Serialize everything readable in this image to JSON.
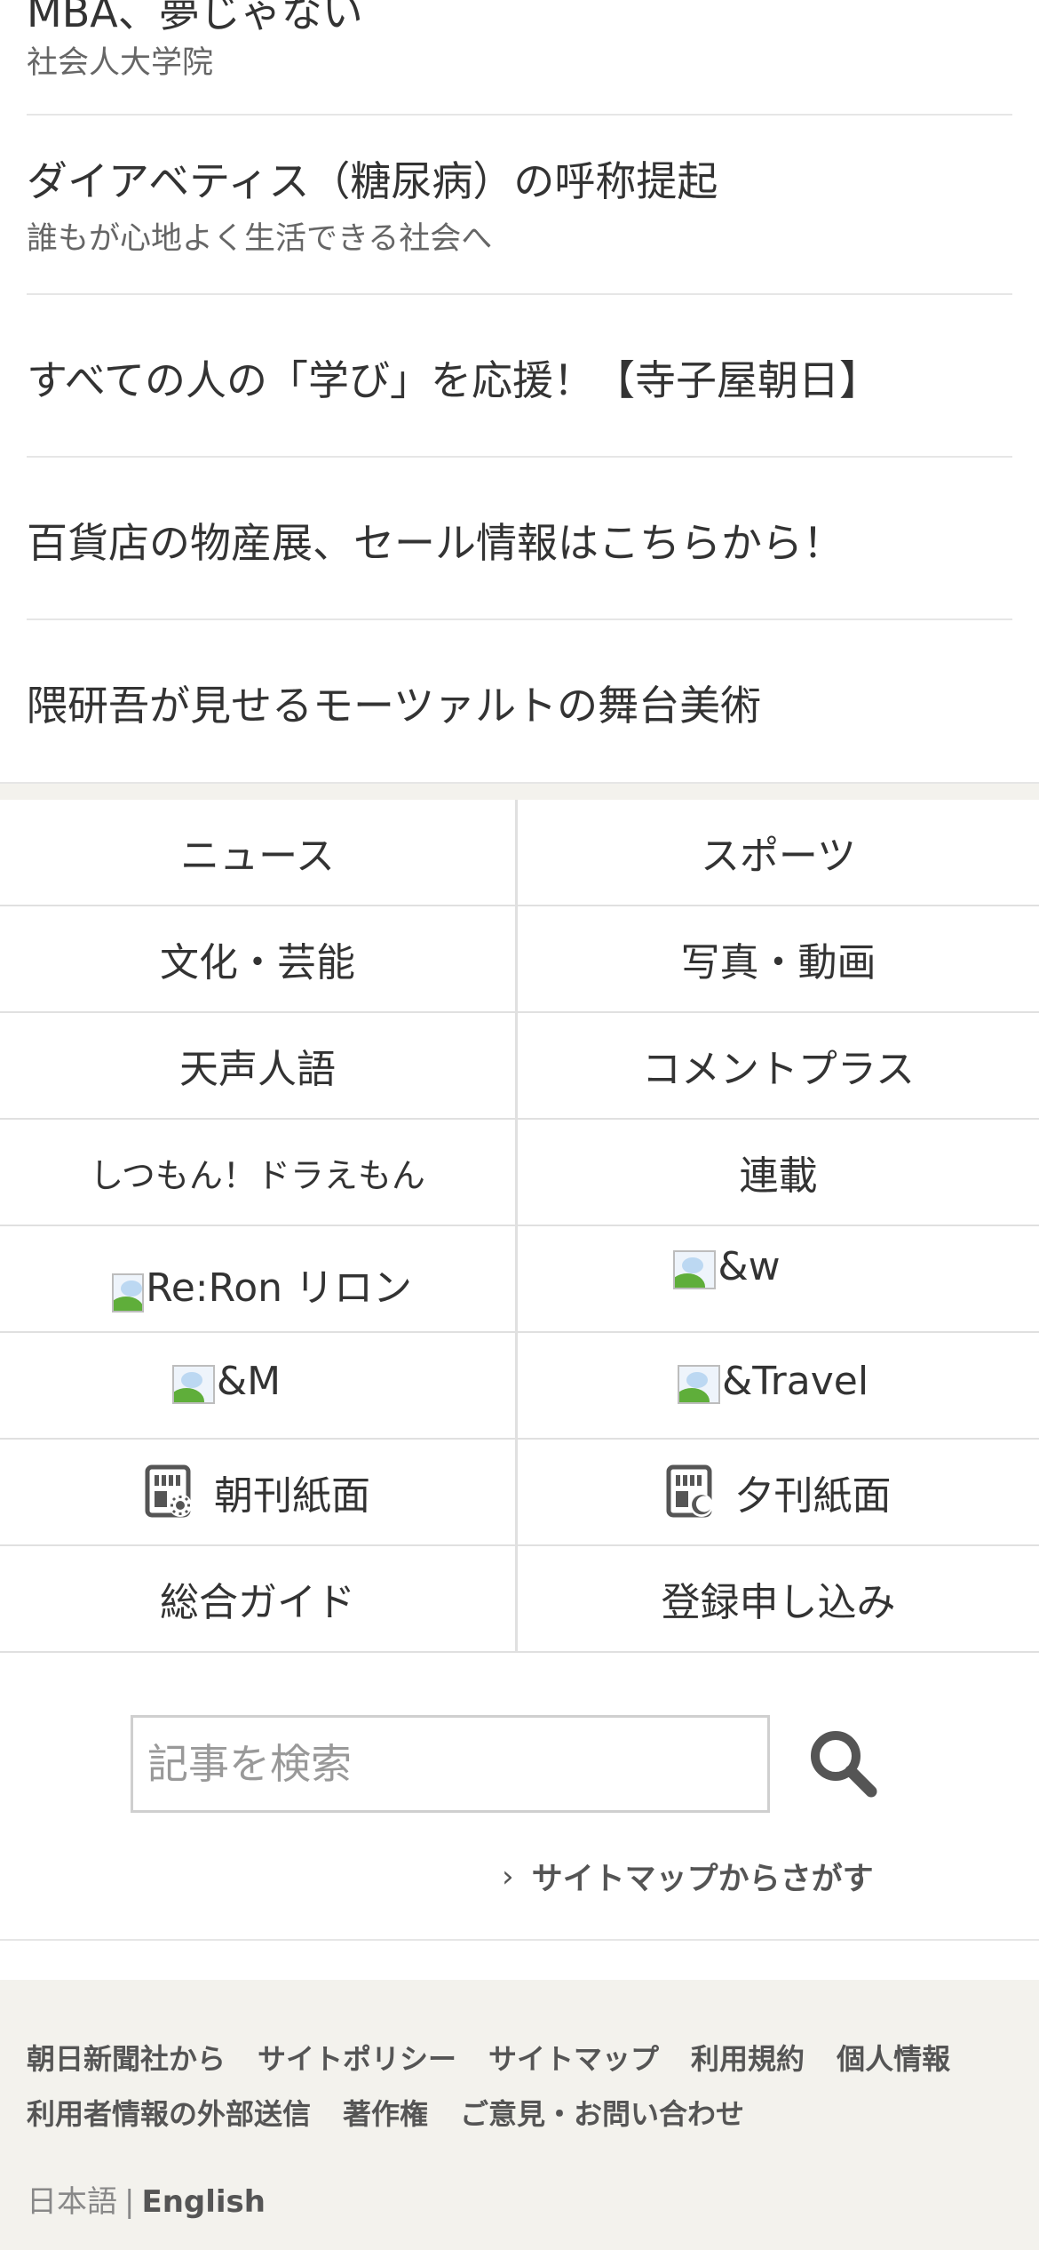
{
  "promos": [
    {
      "title": "MBA、夢じゃない",
      "subtitle": "社会人大学院"
    },
    {
      "title": "ダイアベティス（糖尿病）の呼称提起",
      "subtitle": "誰もが心地よく生活できる社会へ"
    },
    {
      "title": "すべての人の「学び」を応援！【寺子屋朝日】",
      "subtitle": ""
    },
    {
      "title": "百貨店の物産展、セール情報はこちらから！",
      "subtitle": ""
    },
    {
      "title": "隈研吾が見せるモーツァルトの舞台美術",
      "subtitle": ""
    }
  ],
  "nav": {
    "news": "ニュース",
    "sports": "スポーツ",
    "culture": "文化・芸能",
    "photo_video": "写真・動画",
    "tensei": "天声人語",
    "comment_plus": "コメントプラス",
    "doraemon": "しつもん！ドラえもん",
    "series": "連載",
    "reron": "Re:Ron リロン",
    "and_w": "&w",
    "and_m": "&M",
    "and_travel": "&Travel",
    "morning_paper": "朝刊紙面",
    "evening_paper": "夕刊紙面",
    "guide": "総合ガイド",
    "register": "登録申し込み"
  },
  "search": {
    "placeholder": "記事を検索",
    "sitemap_link": "サイトマップからさがす"
  },
  "footer": {
    "links": [
      "朝日新聞社から",
      "サイトポリシー",
      "サイトマップ",
      "利用規約",
      "個人情報",
      "利用者情報の外部送信",
      "著作権",
      "ご意見・お問い合わせ"
    ],
    "lang_ja": "日本語",
    "lang_sep": "|",
    "lang_en": "English"
  }
}
